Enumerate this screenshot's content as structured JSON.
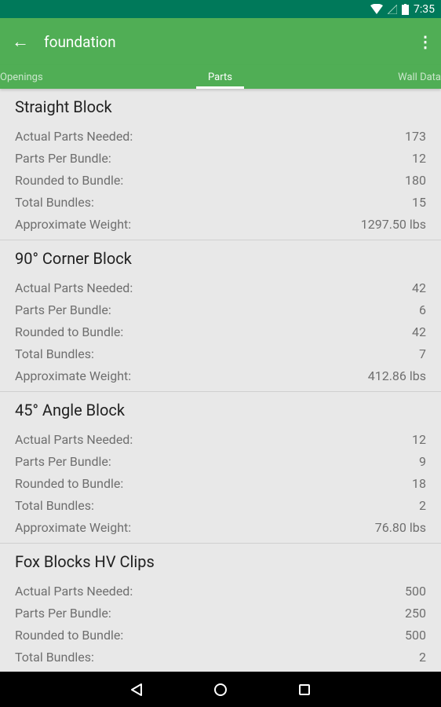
{
  "status": {
    "time": "7:35",
    "icons": [
      "wifi-icon",
      "signal-icon",
      "battery-icon"
    ]
  },
  "toolbar": {
    "title": "foundation",
    "back_icon": "arrow-left-icon",
    "menu_icon": "more-vert-icon"
  },
  "tabs": [
    {
      "label": "Openings"
    },
    {
      "label": "Parts",
      "active": true
    },
    {
      "label": "Wall Data"
    }
  ],
  "colors": {
    "status_bar": "#00795a",
    "toolbar": "#50ae55",
    "background": "#e8e8e8"
  },
  "sections": [
    {
      "title": "Straight Block",
      "rows": [
        {
          "label": "Actual Parts Needed:",
          "value": "173"
        },
        {
          "label": "Parts Per Bundle:",
          "value": "12"
        },
        {
          "label": "Rounded to Bundle:",
          "value": "180"
        },
        {
          "label": "Total Bundles:",
          "value": "15"
        },
        {
          "label": "Approximate Weight:",
          "value": "1297.50 lbs"
        }
      ]
    },
    {
      "title": "90° Corner Block",
      "rows": [
        {
          "label": "Actual Parts Needed:",
          "value": "42"
        },
        {
          "label": "Parts Per Bundle:",
          "value": "6"
        },
        {
          "label": "Rounded to Bundle:",
          "value": "42"
        },
        {
          "label": "Total Bundles:",
          "value": "7"
        },
        {
          "label": "Approximate Weight:",
          "value": "412.86 lbs"
        }
      ]
    },
    {
      "title": "45° Angle Block",
      "rows": [
        {
          "label": "Actual Parts Needed:",
          "value": "12"
        },
        {
          "label": "Parts Per Bundle:",
          "value": "9"
        },
        {
          "label": "Rounded to Bundle:",
          "value": "18"
        },
        {
          "label": "Total Bundles:",
          "value": "2"
        },
        {
          "label": "Approximate Weight:",
          "value": "76.80 lbs"
        }
      ]
    },
    {
      "title": "Fox Blocks HV Clips",
      "rows": [
        {
          "label": "Actual Parts Needed:",
          "value": "500"
        },
        {
          "label": "Parts Per Bundle:",
          "value": "250"
        },
        {
          "label": "Rounded to Bundle:",
          "value": "500"
        },
        {
          "label": "Total Bundles:",
          "value": "2"
        }
      ]
    }
  ]
}
